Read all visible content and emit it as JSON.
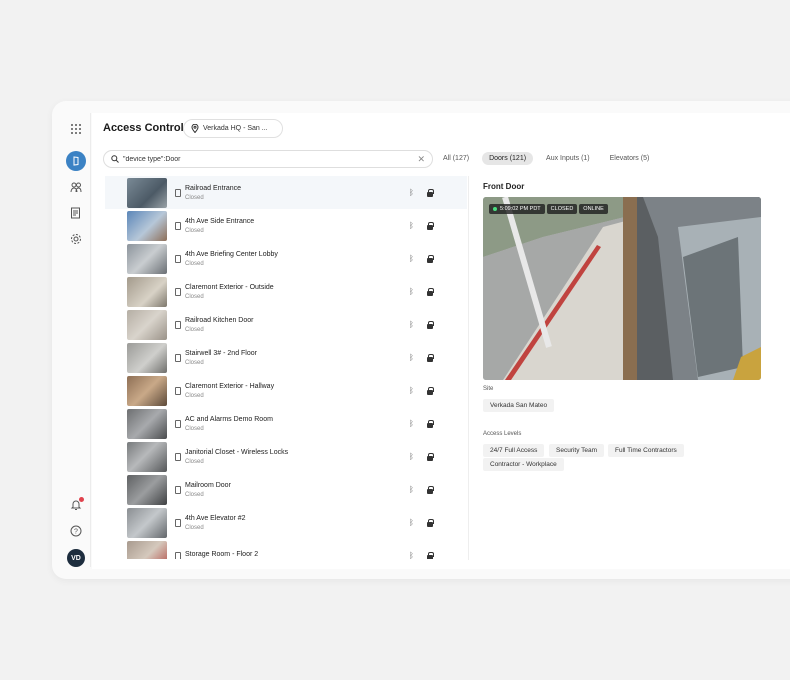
{
  "header": {
    "title": "Access Control",
    "site_selector": "Verkada HQ - San ..."
  },
  "search": {
    "value": "\"device type\":Door"
  },
  "filters": [
    {
      "label": "All (127)"
    },
    {
      "label": "Doors (121)"
    },
    {
      "label": "Aux Inputs (1)"
    },
    {
      "label": "Elevators (5)"
    }
  ],
  "doors": [
    {
      "name": "Railroad Entrance",
      "status": "Closed"
    },
    {
      "name": "4th Ave Side Entrance",
      "status": "Closed"
    },
    {
      "name": "4th Ave Briefing Center Lobby",
      "status": "Closed"
    },
    {
      "name": "Claremont Exterior - Outside",
      "status": "Closed"
    },
    {
      "name": "Railroad Kitchen Door",
      "status": "Closed"
    },
    {
      "name": "Stairwell 3# - 2nd Floor",
      "status": "Closed"
    },
    {
      "name": "Claremont Exterior - Hallway",
      "status": "Closed"
    },
    {
      "name": "AC and Alarms Demo Room",
      "status": "Closed"
    },
    {
      "name": "Janitorial Closet - Wireless Locks",
      "status": "Closed"
    },
    {
      "name": "Mailroom Door",
      "status": "Closed"
    },
    {
      "name": "4th Ave Elevator #2",
      "status": "Closed"
    },
    {
      "name": "Storage Room - Floor 2",
      "status": ""
    }
  ],
  "detail": {
    "title": "Front Door",
    "camera": {
      "time": "5:09:02 PM PDT",
      "door_state": "CLOSED",
      "connection": "ONLINE"
    },
    "site_label": "Site",
    "site": "Verkada San Mateo",
    "access_levels_label": "Access Levels",
    "access_levels": [
      "24/7 Full Access",
      "Security Team",
      "Full Time Contractors",
      "Contractor - Workplace"
    ]
  },
  "user": {
    "initials": "VD"
  },
  "colors": {
    "brand": "#3b82c4",
    "online": "#4ade80",
    "notification": "#e0424d"
  }
}
